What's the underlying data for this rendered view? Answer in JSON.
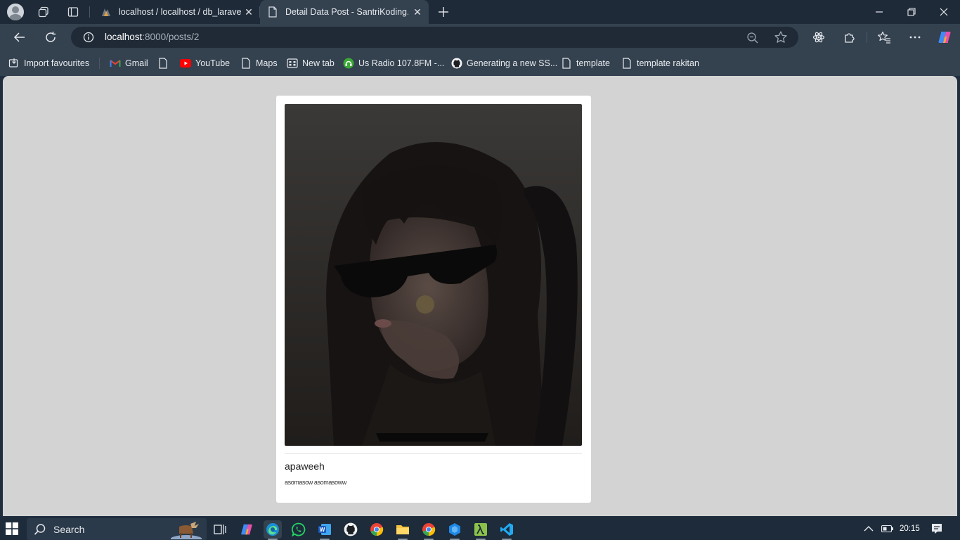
{
  "browser": {
    "tabs": [
      {
        "title": "localhost / localhost / db_laravel_",
        "active": false
      },
      {
        "title": "Detail Data Post - SantriKoding.co",
        "active": true
      }
    ],
    "address": {
      "host": "localhost",
      "rest": ":8000/posts/2"
    },
    "bookmarks": [
      "Import favourites",
      "Gmail",
      "YouTube",
      "Maps",
      "New tab",
      "Us Radio 107.8FM -...",
      "Generating a new SS...",
      "template",
      "template rakitan"
    ]
  },
  "post": {
    "image_alt": "Post image",
    "title": "apaweeh",
    "content": "asomasow asomasoww"
  },
  "taskbar": {
    "search_label": "Search",
    "time": "20:15"
  },
  "colors": {
    "titlebar": "#1e2a38",
    "toolbar": "#34414f",
    "page_background": "#d3d3d3",
    "card": "#ffffff",
    "taskbar": "#1d2b3a"
  }
}
